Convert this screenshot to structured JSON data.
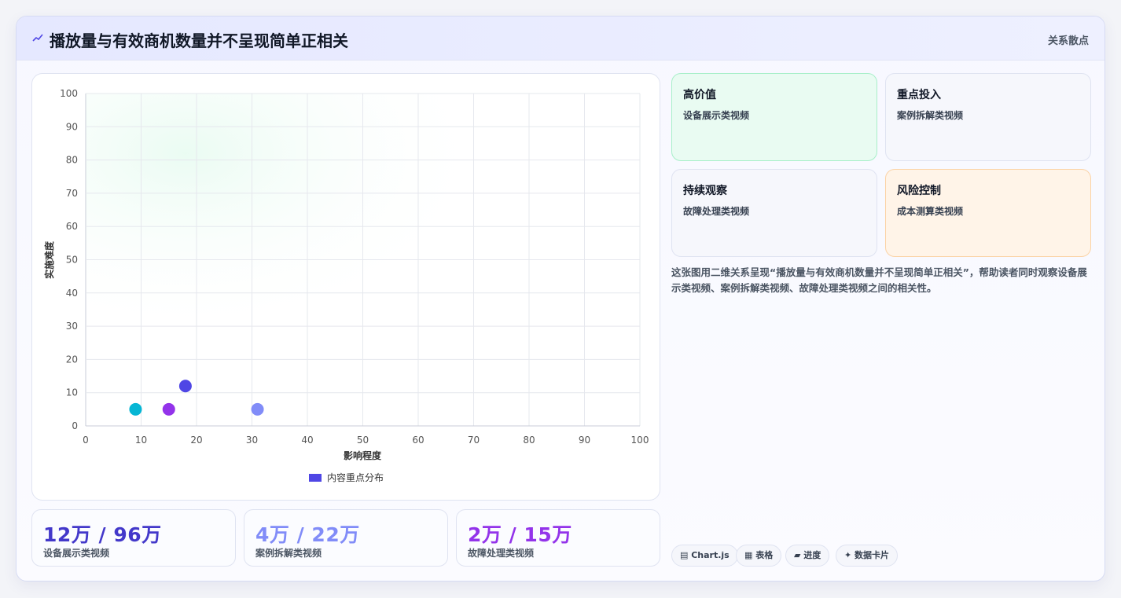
{
  "header": {
    "icon": "trend-icon",
    "title": "播放量与有效商机数量并不呈现简单正相关",
    "tag": "关系散点"
  },
  "chart_data": {
    "type": "scatter",
    "xlabel": "影响程度",
    "ylabel": "实施难度",
    "xlim": [
      0,
      100
    ],
    "ylim": [
      0,
      100
    ],
    "xticks": [
      "0",
      "10",
      "20",
      "30",
      "40",
      "50",
      "60",
      "70",
      "80",
      "90",
      "100"
    ],
    "yticks": [
      "0",
      "10",
      "20",
      "30",
      "40",
      "50",
      "60",
      "70",
      "80",
      "90",
      "100"
    ],
    "grid": true,
    "legend_position": "bottom",
    "series": [
      {
        "name": "内容重点分布",
        "color": "#4f46e5",
        "points": [
          {
            "x": 18,
            "y": 12,
            "color": "#4f46e5"
          },
          {
            "x": 31,
            "y": 5,
            "color": "#818cf8"
          },
          {
            "x": 15,
            "y": 5,
            "color": "#9333ea"
          },
          {
            "x": 9,
            "y": 5,
            "color": "#06b6d4"
          }
        ]
      }
    ]
  },
  "stats": [
    {
      "value": "12万 / 96万",
      "label": "设备展示类视频",
      "color": "#4338ca"
    },
    {
      "value": "4万 / 22万",
      "label": "案例拆解类视频",
      "color": "#818cf8"
    },
    {
      "value": "2万 / 15万",
      "label": "故障处理类视频",
      "color": "#9333ea"
    }
  ],
  "quadrants": [
    {
      "title": "高价值",
      "sub": "设备展示类视频"
    },
    {
      "title": "重点投入",
      "sub": "案例拆解类视频"
    },
    {
      "title": "持续观察",
      "sub": "故障处理类视频"
    },
    {
      "title": "风险控制",
      "sub": "成本测算类视频"
    }
  ],
  "description": "这张图用二维关系呈现“播放量与有效商机数量并不呈现简单正相关”，帮助读者同时观察设备展示类视频、案例拆解类视频、故障处理类视频之间的相关性。",
  "chips": [
    "▤ Chart.js",
    "▦ 表格",
    "▰ 进度",
    "✦ 数据卡片"
  ]
}
